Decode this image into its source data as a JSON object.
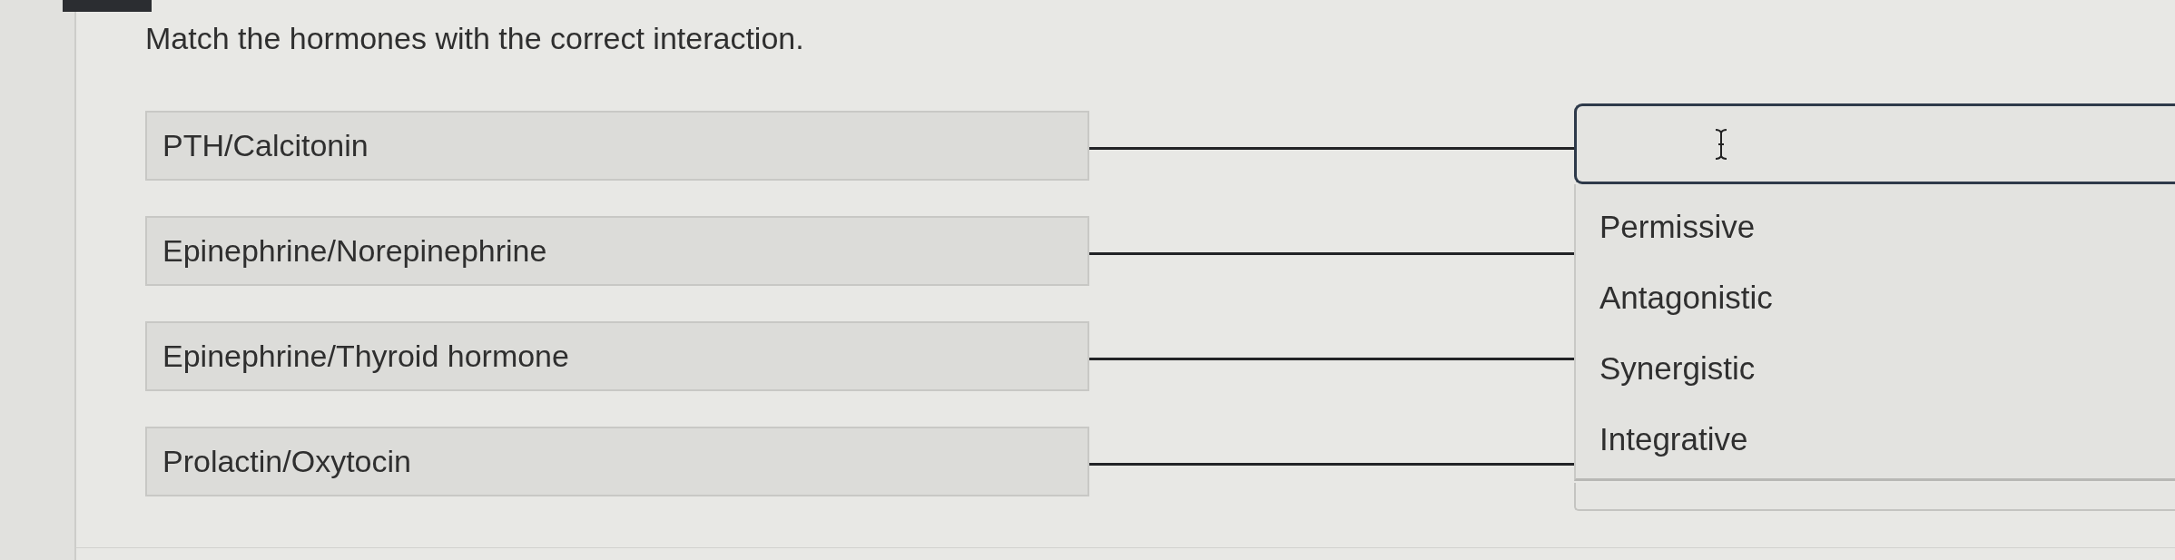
{
  "prompt": "Match the hormones with the correct interaction.",
  "premises": [
    "PTH/Calcitonin",
    "Epinephrine/Norepinephrine",
    "Epinephrine/Thyroid hormone",
    "Prolactin/Oxytocin"
  ],
  "answer_dropdown": {
    "expanded": true,
    "options": [
      {
        "label": "Permissive",
        "selected": false
      },
      {
        "label": "Antagonistic",
        "selected": false
      },
      {
        "label": "Synergistic",
        "selected": false
      },
      {
        "label": "Integrative",
        "selected": false
      }
    ]
  }
}
